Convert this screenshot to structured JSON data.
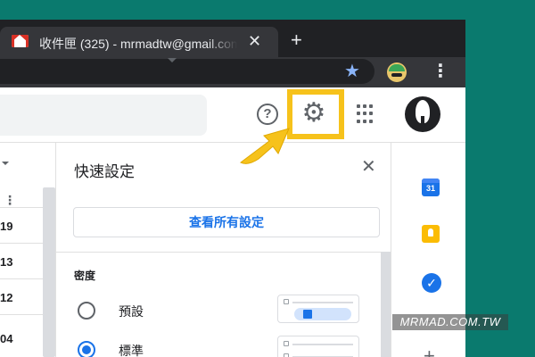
{
  "browser": {
    "tab_title": "收件匣 (325) - mrmadtw@gmail.com",
    "tab_close": "✕",
    "new_tab": "+",
    "star": "★",
    "menu": "⋮",
    "favicon": "gmail-icon"
  },
  "header": {
    "help": "?",
    "gear": "⚙",
    "accent_color": "#f6c21b"
  },
  "mail_list": {
    "more": "⋮",
    "dates": [
      "19",
      "13",
      "12",
      "04"
    ]
  },
  "quick_settings": {
    "title": "快速設定",
    "close": "✕",
    "view_all": "查看所有設定",
    "density_section": "密度",
    "options": [
      {
        "label": "預設",
        "selected": false
      },
      {
        "label": "標準",
        "selected": true
      }
    ]
  },
  "side_panel": {
    "calendar_day": "31",
    "tasks_check": "✓",
    "add": "+"
  },
  "watermark": "MRMAD.COM.TW",
  "colors": {
    "background": "#0a7a6e",
    "link_blue": "#1a73e8",
    "highlight_yellow": "#f6c21b"
  }
}
